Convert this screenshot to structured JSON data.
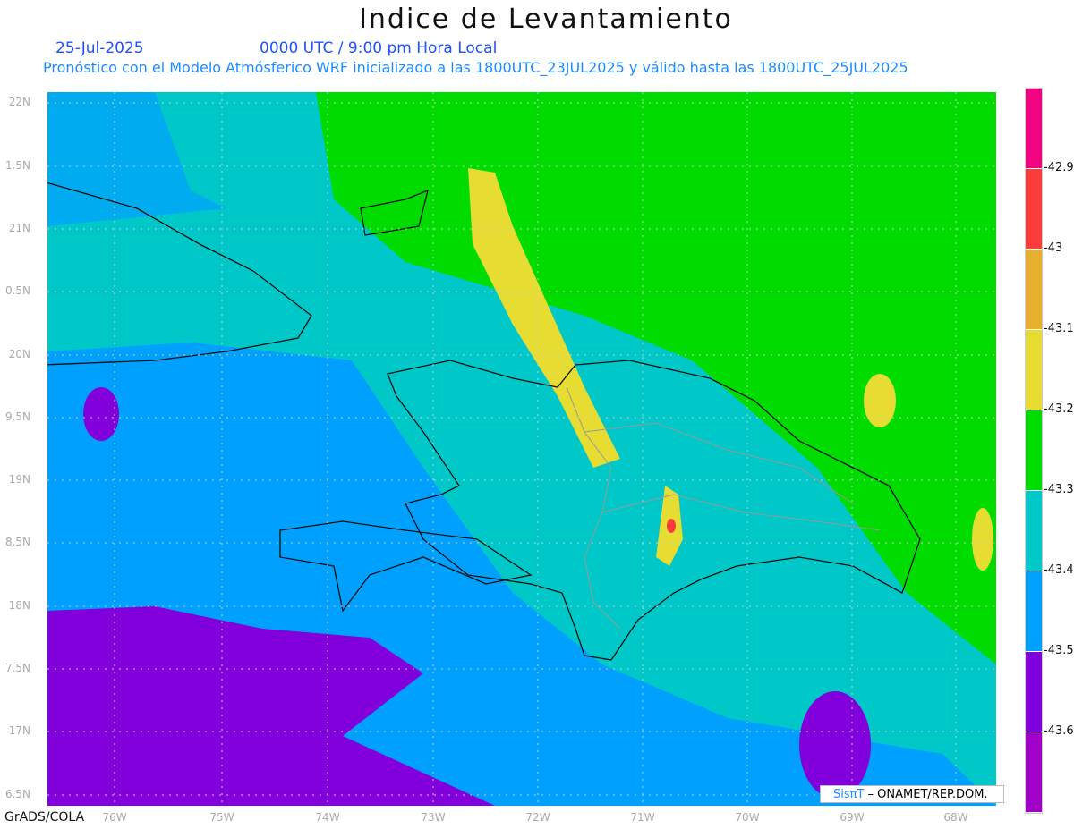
{
  "title": "Indice de Levantamiento",
  "date": "25-Jul-2025",
  "time": "0000 UTC / 9:00 pm Hora Local",
  "subtitle": "Pronóstico con el Modelo Atmósferico WRF inicializado a las 1800UTC_23JUL2025 y válido hasta las  1800UTC_25JUL2025",
  "y_labels": [
    "22N",
    "1.5N",
    "21N",
    "0.5N",
    "20N",
    "9.5N",
    "19N",
    "8.5N",
    "18N",
    "7.5N",
    "17N",
    "6.5N"
  ],
  "x_labels": [
    "76W",
    "75W",
    "74W",
    "73W",
    "72W",
    "71W",
    "70W",
    "69W",
    "68W"
  ],
  "footer": "GrADS/COLA",
  "credit": {
    "logo": "SisπΤ",
    "text": "– ONAMET/REP.DOM."
  },
  "colorbar": {
    "colors": [
      "#f0047f",
      "#fa3c3c",
      "#e6af2d",
      "#e6dc32",
      "#00dc00",
      "#00c8c8",
      "#00a0ff",
      "#8200dc",
      "#a000c8"
    ],
    "labels": [
      "-42.9",
      "-43",
      "-43.1",
      "-43.2",
      "-43.3",
      "-43.4",
      "-43.5",
      "-43.6"
    ]
  }
}
